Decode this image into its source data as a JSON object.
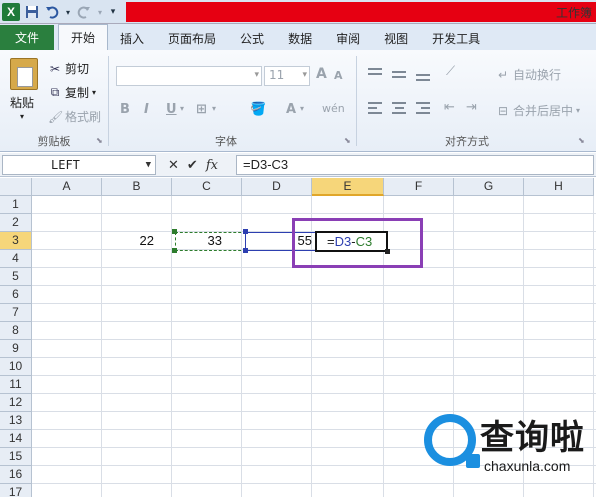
{
  "app": {
    "window_title": "工作簿",
    "logo": "X"
  },
  "quick_access": {
    "icons": [
      "excel-logo",
      "save-icon",
      "undo-icon",
      "redo-icon",
      "customize-icon"
    ]
  },
  "tabs": [
    {
      "label": "文件"
    },
    {
      "label": "开始"
    },
    {
      "label": "插入"
    },
    {
      "label": "页面布局"
    },
    {
      "label": "公式"
    },
    {
      "label": "数据"
    },
    {
      "label": "审阅"
    },
    {
      "label": "视图"
    },
    {
      "label": "开发工具"
    }
  ],
  "ribbon": {
    "clipboard": {
      "paste": "粘贴",
      "cut": "剪切",
      "copy": "复制",
      "format_painter": "格式刷",
      "group": "剪贴板"
    },
    "font": {
      "size": "11",
      "bold": "B",
      "italic": "I",
      "underline": "U",
      "grow": "A",
      "shrink": "A",
      "font_color": "A",
      "wen": "wén",
      "group": "字体"
    },
    "alignment": {
      "wrap": "自动换行",
      "merge": "合并后居中",
      "group": "对齐方式"
    }
  },
  "formula_bar": {
    "name_box": "LEFT",
    "cancel": "✕",
    "enter": "✔",
    "fx": "fx",
    "formula": "=D3-C3"
  },
  "sheet": {
    "columns": [
      "A",
      "B",
      "C",
      "D",
      "E",
      "F",
      "G",
      "H"
    ],
    "rows": [
      "1",
      "2",
      "3",
      "4",
      "5",
      "6",
      "7",
      "8",
      "9",
      "10",
      "11",
      "12",
      "13",
      "14",
      "15",
      "16",
      "17"
    ],
    "cells": {
      "B3": "22",
      "C3": "33",
      "D3": "55"
    },
    "edit_cell": {
      "eq": "=",
      "ref1": "D3",
      "minus": "-",
      "ref2": "C3"
    }
  },
  "watermark": {
    "title": "查询啦",
    "url": "chaxunla.com"
  },
  "colors": {
    "file_tab": "#2a7f3e",
    "title_red": "#e60012",
    "ref_green": "#2d7c2d",
    "ref_blue": "#2d3fb0",
    "highlight_purple": "#8a3fb5",
    "watermark_blue": "#1b8fe0"
  }
}
